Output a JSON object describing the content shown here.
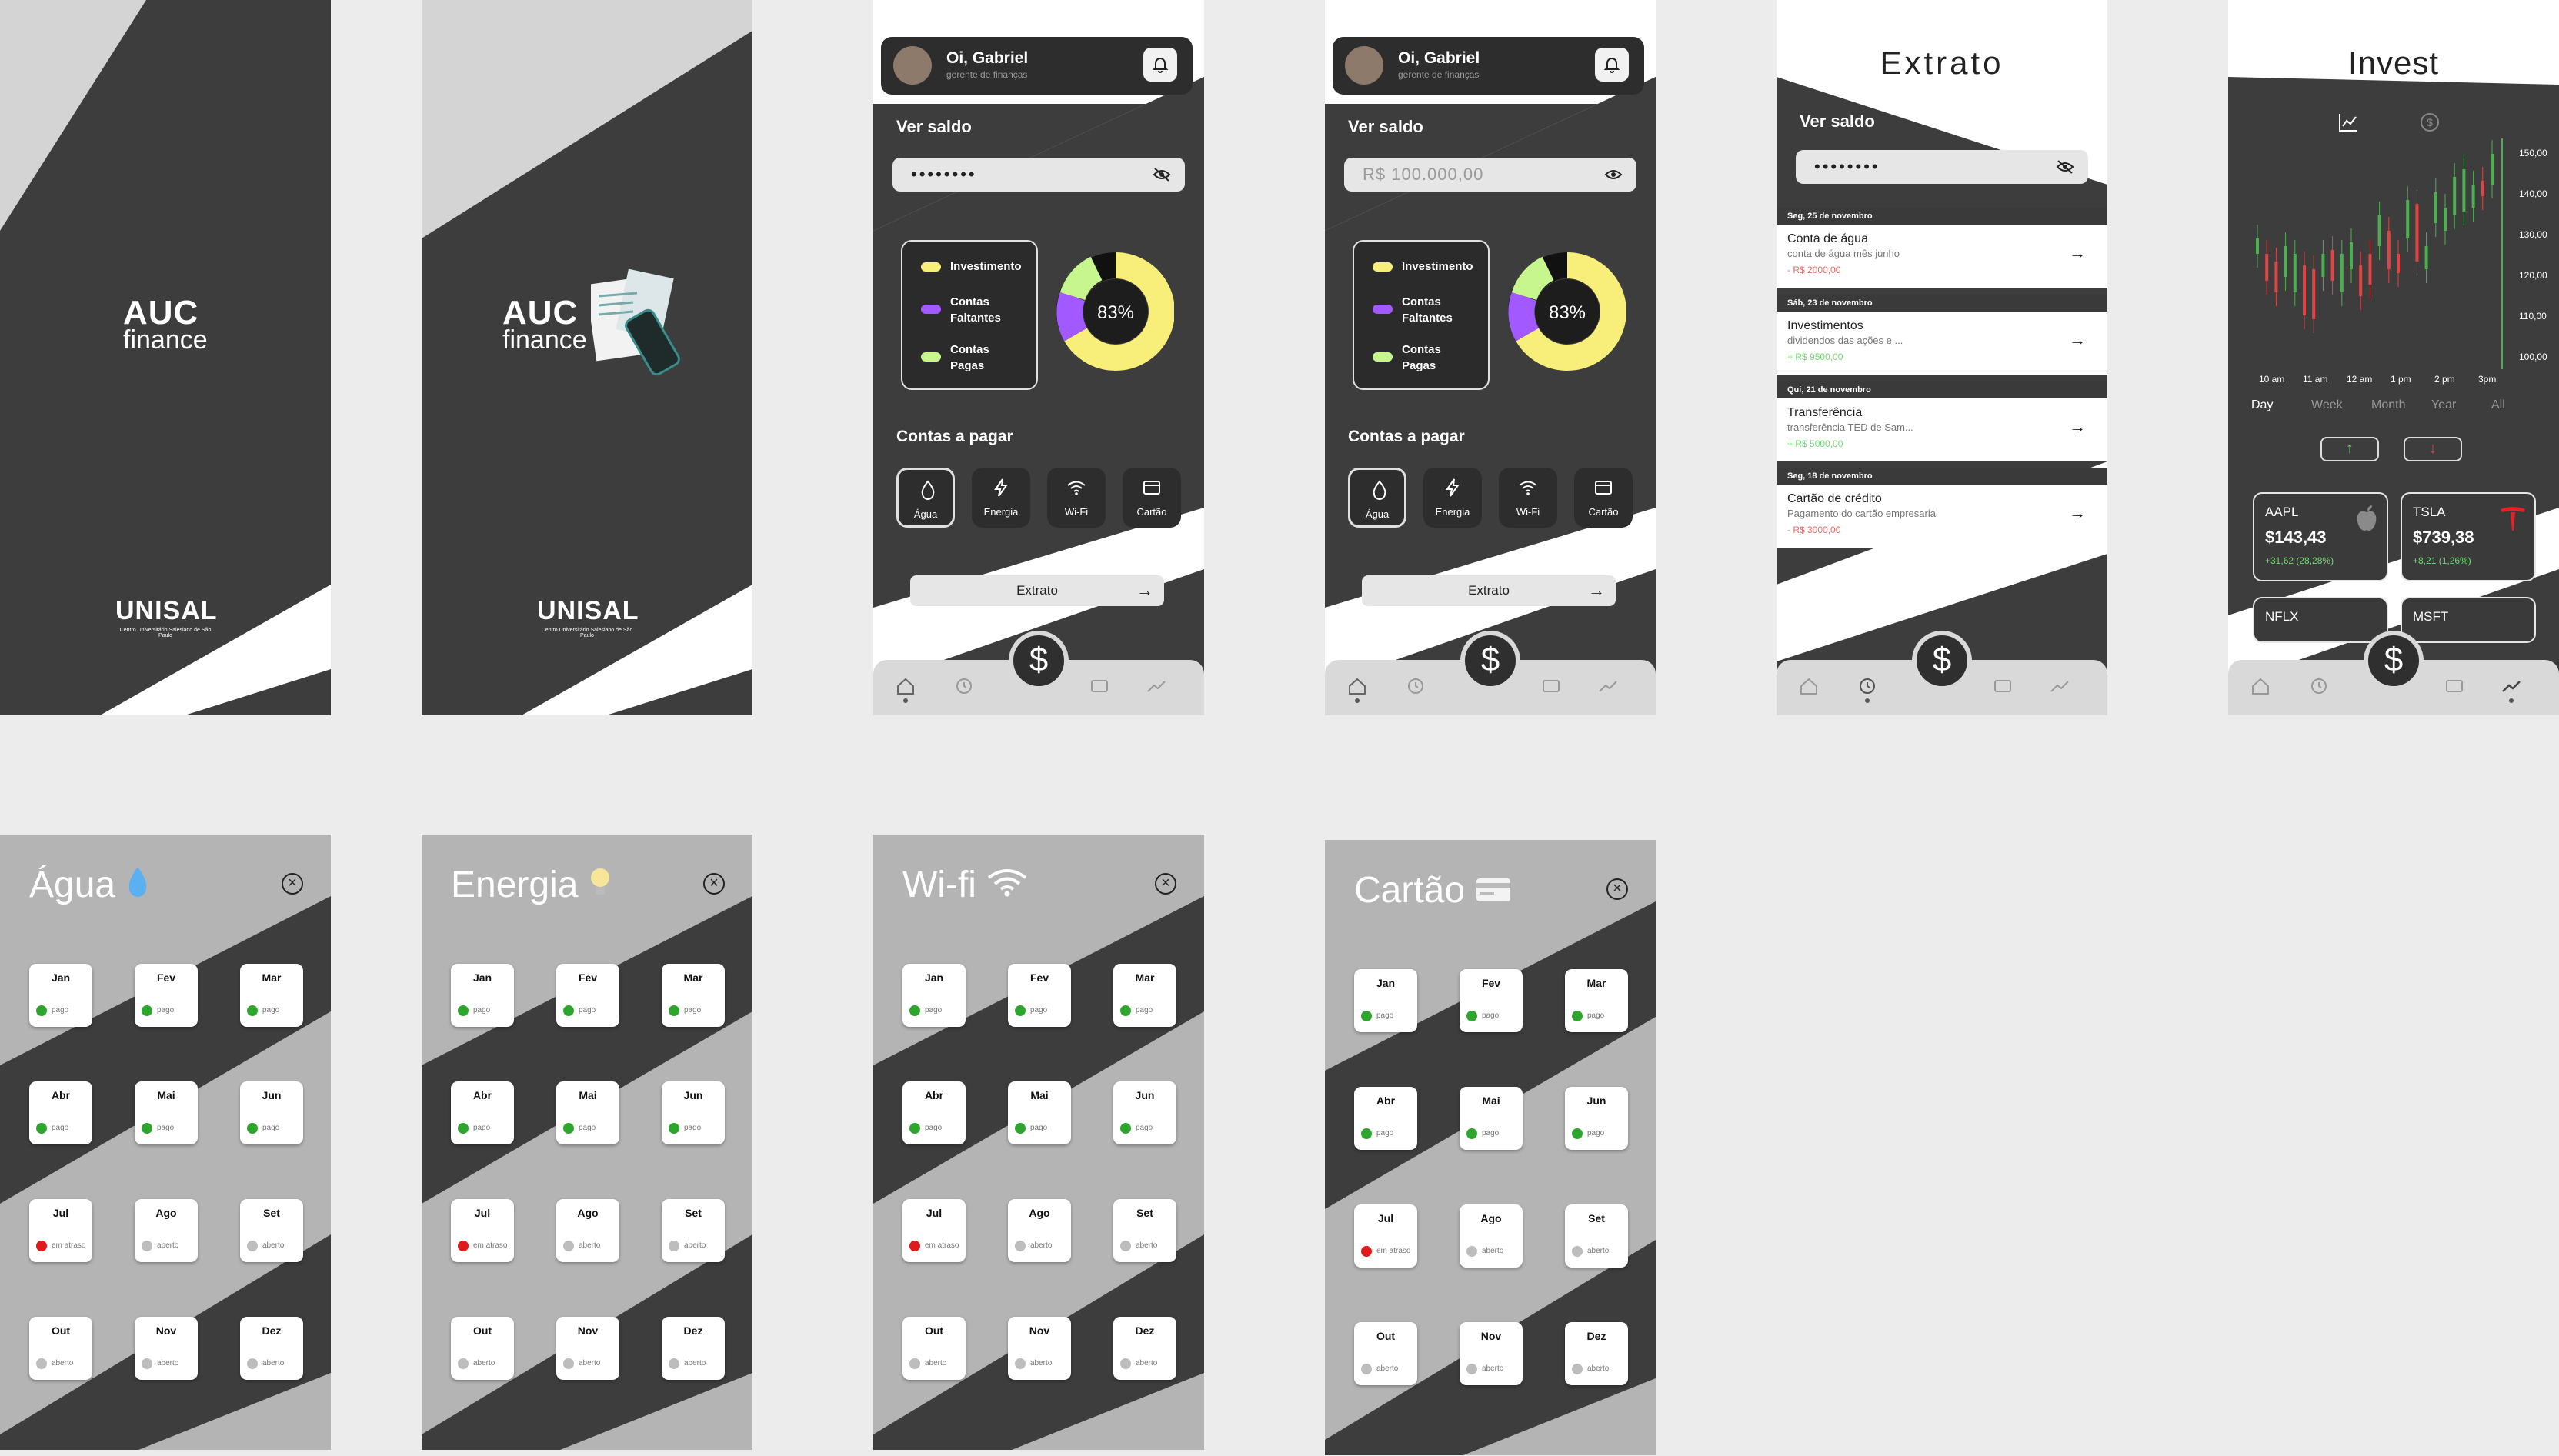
{
  "brand": {
    "line1": "AUC",
    "line2": "finance"
  },
  "university": {
    "name": "UNISAL",
    "tagline": "Centro Universitário Salesiano de São Paulo"
  },
  "home": {
    "greeting": "Oi, Gabriel",
    "role": "gerente de finanças",
    "balance_label": "Ver saldo",
    "balance_masked": "••••••••",
    "balance_value": "R$ 100.000,00",
    "legend": [
      "Investimento",
      "Contas Faltantes",
      "Contas Pagas"
    ],
    "donut_percent": 0.83,
    "donut_label": "83%",
    "bills_label": "Contas a pagar",
    "bills": [
      "Água",
      "Energia",
      "Wi-Fi",
      "Cartão"
    ],
    "statement_button": "Extrato"
  },
  "statement": {
    "title": "Extrato",
    "balance_label": "Ver saldo",
    "balance_masked": "••••••••",
    "groups": [
      {
        "date": "Seg, 25 de novembro",
        "name": "Conta de água",
        "desc": "conta de água mês junho",
        "value": "- R$ 2000,00",
        "type": "out"
      },
      {
        "date": "Sáb, 23 de novembro",
        "name": "Investimentos",
        "desc": "dividendos das ações e ...",
        "value": "+ R$ 9500,00",
        "type": "in"
      },
      {
        "date": "Qui, 21 de novembro",
        "name": "Transferência",
        "desc": "transferência TED de Sam...",
        "value": "+ R$ 5000,00",
        "type": "in"
      },
      {
        "date": "Seg, 18 de novembro",
        "name": "Cartão de crédito",
        "desc": "Pagamento do cartão empresarial",
        "value": "- R$ 3000,00",
        "type": "out"
      }
    ]
  },
  "invest": {
    "title": "Invest",
    "y_ticks": [
      "150,00",
      "140,00",
      "130,00",
      "120,00",
      "110,00",
      "100,00"
    ],
    "x_ticks": [
      "10 am",
      "11 am",
      "12 am",
      "1 pm",
      "2 pm",
      "3pm"
    ],
    "timeframes": [
      "Day",
      "Week",
      "Month",
      "Year",
      "All"
    ],
    "active_timeframe": "Day",
    "stocks": [
      {
        "symbol": "AAPL",
        "price": "$143,43",
        "change": "+31,62 (28,28%)"
      },
      {
        "symbol": "TSLA",
        "price": "$739,38",
        "change": "+8,21 (1,26%)"
      }
    ],
    "partial_stocks": [
      "NFLX",
      "MSFT"
    ]
  },
  "months": [
    "Jan",
    "Fev",
    "Mar",
    "Abr",
    "Mai",
    "Jun",
    "Jul",
    "Ago",
    "Set",
    "Out",
    "Nov",
    "Dez"
  ],
  "status": [
    "pago",
    "pago",
    "pago",
    "pago",
    "pago",
    "pago",
    "em atraso",
    "aberto",
    "aberto",
    "aberto",
    "aberto",
    "aberto"
  ],
  "modals": [
    {
      "title": "Água",
      "icon": "water-drop-icon"
    },
    {
      "title": "Energia",
      "icon": "light-bulb-icon"
    },
    {
      "title": "Wi-fi",
      "icon": "wifi-icon"
    },
    {
      "title": "Cartão",
      "icon": "credit-card-icon"
    }
  ],
  "colors": {
    "yellow": "#f7ef7a",
    "purple": "#a259ff",
    "green": "#c6f68d",
    "paid": "#2ea62e",
    "late": "#e01b1b",
    "open": "#bdbdbd",
    "candle_up": "#4caf50",
    "candle_down": "#e04444"
  }
}
